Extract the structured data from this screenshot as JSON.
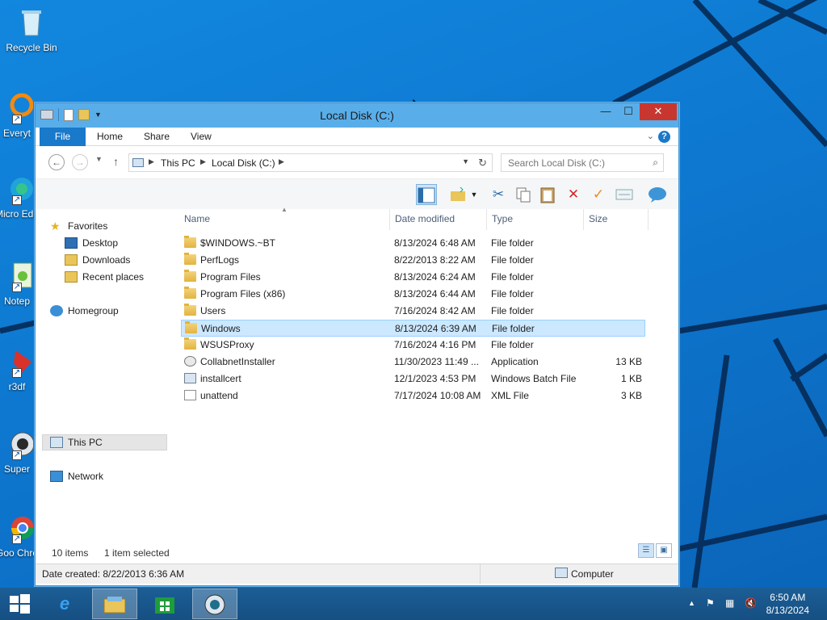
{
  "desktop": {
    "icons": [
      {
        "label": "Recycle Bin"
      },
      {
        "label": "Everyt"
      },
      {
        "label": "Micro Edg"
      },
      {
        "label": "Notep"
      },
      {
        "label": "r3df"
      },
      {
        "label": "Super"
      },
      {
        "label": "Goo Chro"
      }
    ]
  },
  "window": {
    "title": "Local Disk (C:)",
    "ribbon": {
      "file": "File",
      "home": "Home",
      "share": "Share",
      "view": "View"
    },
    "address": {
      "this_pc": "This PC",
      "drive": "Local Disk (C:)"
    },
    "search": {
      "placeholder": "Search Local Disk (C:)"
    },
    "nav_pane": {
      "favorites": "Favorites",
      "desktop": "Desktop",
      "downloads": "Downloads",
      "recent": "Recent places",
      "homegroup": "Homegroup",
      "this_pc": "This PC",
      "network": "Network"
    },
    "columns": {
      "name": "Name",
      "date": "Date modified",
      "type": "Type",
      "size": "Size"
    },
    "files": [
      {
        "name": "$WINDOWS.~BT",
        "date": "8/13/2024 6:48 AM",
        "type": "File folder",
        "size": "",
        "icon": "folder-icon"
      },
      {
        "name": "PerfLogs",
        "date": "8/22/2013 8:22 AM",
        "type": "File folder",
        "size": "",
        "icon": "folder-icon"
      },
      {
        "name": "Program Files",
        "date": "8/13/2024 6:24 AM",
        "type": "File folder",
        "size": "",
        "icon": "folder-icon"
      },
      {
        "name": "Program Files (x86)",
        "date": "8/13/2024 6:44 AM",
        "type": "File folder",
        "size": "",
        "icon": "folder-icon"
      },
      {
        "name": "Users",
        "date": "7/16/2024 8:42 AM",
        "type": "File folder",
        "size": "",
        "icon": "folder-icon"
      },
      {
        "name": "Windows",
        "date": "8/13/2024 6:39 AM",
        "type": "File folder",
        "size": "",
        "icon": "folder-icon"
      },
      {
        "name": "WSUSProxy",
        "date": "7/16/2024 4:16 PM",
        "type": "File folder",
        "size": "",
        "icon": "folder-icon"
      },
      {
        "name": "CollabnetInstaller",
        "date": "11/30/2023 11:49 ...",
        "type": "Application",
        "size": "13 KB",
        "icon": "application-icon"
      },
      {
        "name": "installcert",
        "date": "12/1/2023 4:53 PM",
        "type": "Windows Batch File",
        "size": "1 KB",
        "icon": "batch-file-icon"
      },
      {
        "name": "unattend",
        "date": "7/17/2024 10:08 AM",
        "type": "XML File",
        "size": "3 KB",
        "icon": "xml-file-icon"
      }
    ],
    "selected_index": 5,
    "status": {
      "count": "10 items",
      "selected": "1 item selected"
    },
    "details": {
      "created": "Date created: 8/22/2013 6:36 AM",
      "location": "Computer"
    }
  },
  "taskbar": {
    "clock_time": "6:50 AM",
    "clock_date": "8/13/2024"
  },
  "colors": {
    "accent": "#1979ca",
    "selection": "#cce8ff",
    "close": "#c7372f",
    "titlebar": "#59aee9"
  }
}
